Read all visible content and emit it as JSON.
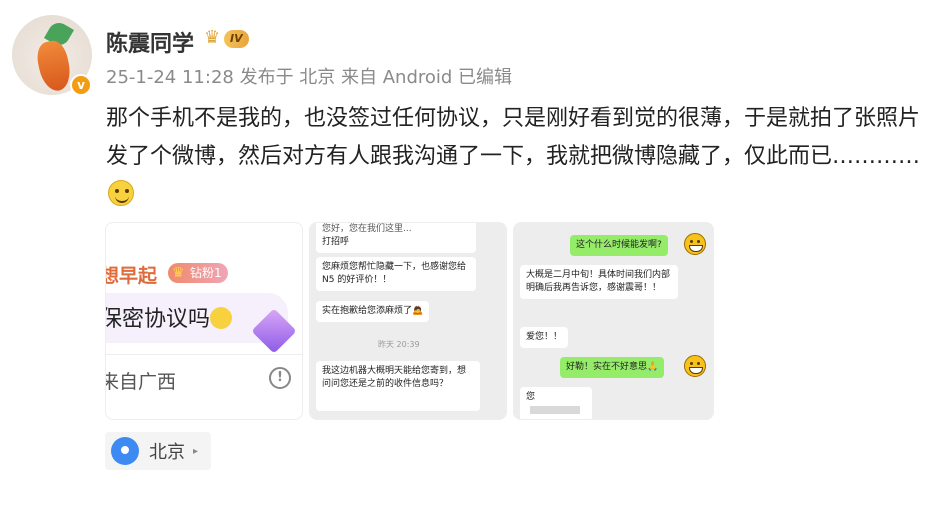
{
  "post": {
    "username": "陈震同学",
    "level": "IV",
    "avatar_badge": "v",
    "meta": "25-1-24 11:28 发布于 北京 来自 Android 已编辑",
    "text": "那个手机不是我的，也没签过任何协议，只是刚好看到觉的很薄，于是就拍了张照片发了个微博，然后对方有人跟我沟通了一下，我就把微博隐藏了，仅此而已…………"
  },
  "images": {
    "img1": {
      "name": "想早起",
      "fan_badge": "钻粉1",
      "text": "保密协议吗",
      "location": "来自广西",
      "warn": "!"
    },
    "img2": {
      "b0": "您好，您在我们这里...",
      "b0b": "打招呼",
      "b1": "您麻烦您帮忙隐藏一下，也感谢您给 N5 的好评价！！",
      "b2": "实在抱歉给您添麻烦了🙇",
      "ts": "昨天 20:39",
      "b3": "我这边机器大概明天能给您寄到，想问问您还是之前的收件信息吗？"
    },
    "img3": {
      "g1": "这个什么时候能发啊?",
      "w1": "大概是二月中旬！具体时间我们内部明确后我再告诉您，感谢震哥！！",
      "w2": "爱您！！",
      "g2": "好勒！实在不好意思🙏",
      "w3": "您"
    }
  },
  "location_chip": {
    "label": "北京",
    "arrow": "▸"
  }
}
